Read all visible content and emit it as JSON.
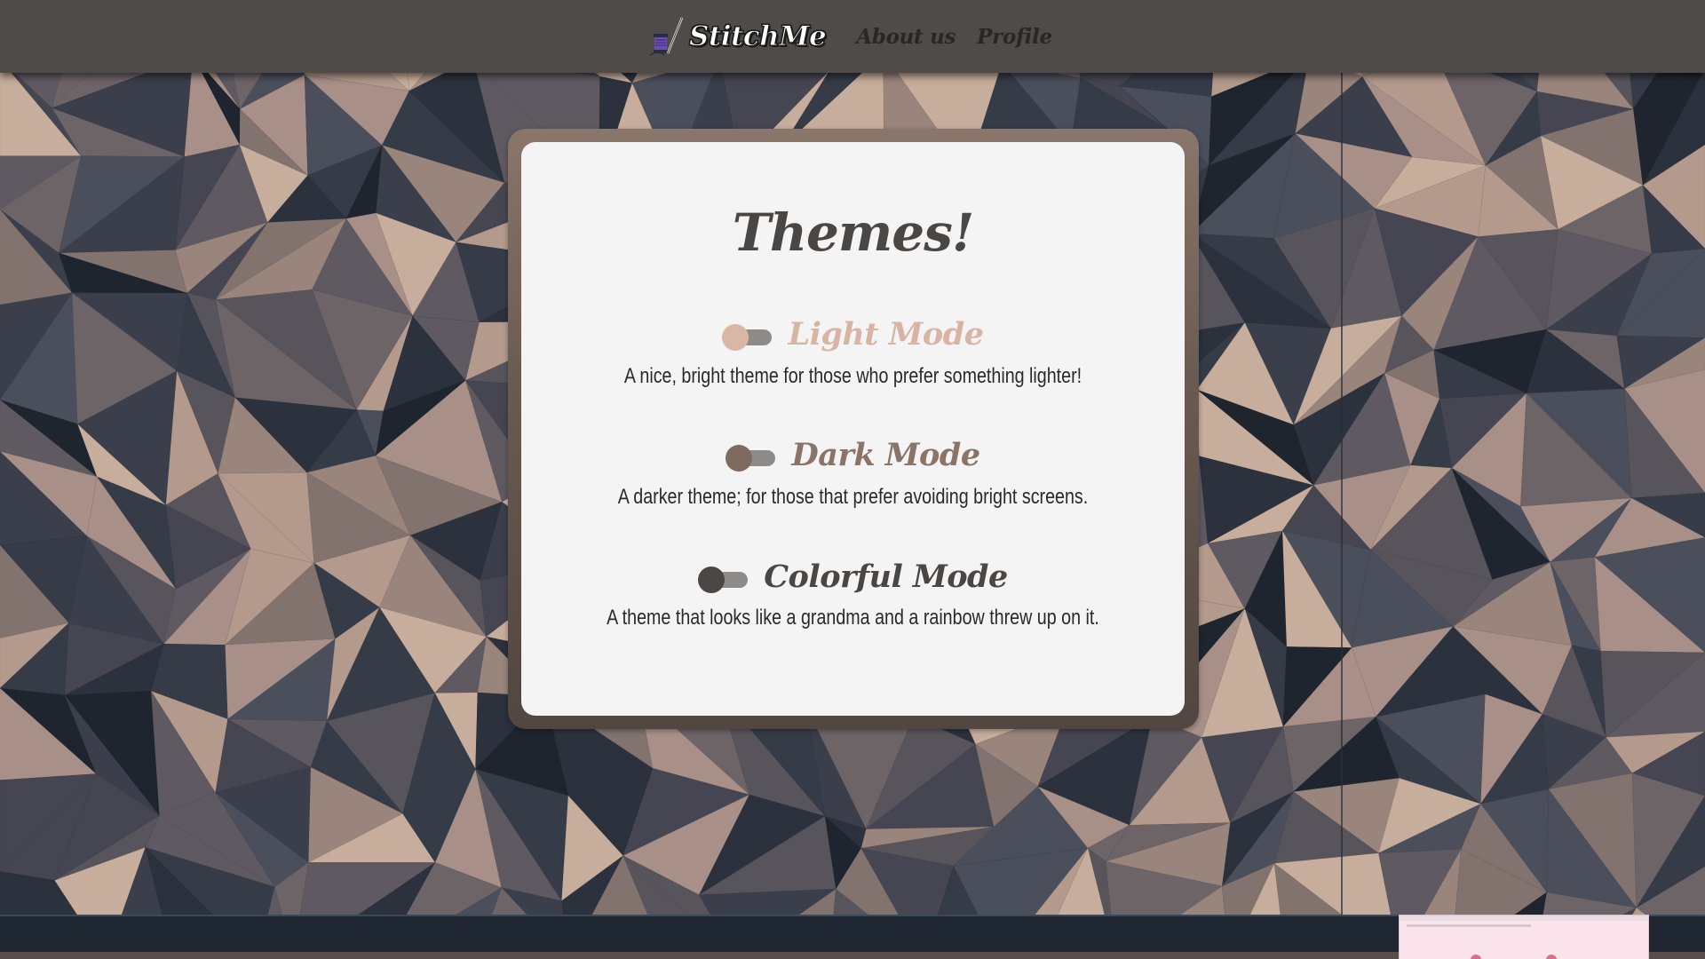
{
  "nav": {
    "brand_name": "StitchMe",
    "brand_icon": "sewing-spool-needle-icon",
    "links": [
      {
        "label": "About us"
      },
      {
        "label": "Profile"
      }
    ]
  },
  "themes_card": {
    "title": "Themes!",
    "options": [
      {
        "label": "Light Mode",
        "description": "A nice, bright theme for those who prefer something lighter!",
        "label_color": "#d8b4a4",
        "knob_color": "#d9b6a6",
        "enabled": false
      },
      {
        "label": "Dark Mode",
        "description": "A darker theme; for those that prefer avoiding bright screens.",
        "label_color": "#8a7468",
        "knob_color": "#7f6a60",
        "enabled": false
      },
      {
        "label": "Colorful Mode",
        "description": "A theme that looks like a grandma and a rainbow threw up on it.",
        "label_color": "#4a4644",
        "knob_color": "#4a4644",
        "enabled": false
      }
    ]
  },
  "colors": {
    "navbar": "#4f4b48",
    "card_bg": "#f4f4f4",
    "card_frame": "#6b5c52",
    "title": "#4a4644"
  }
}
